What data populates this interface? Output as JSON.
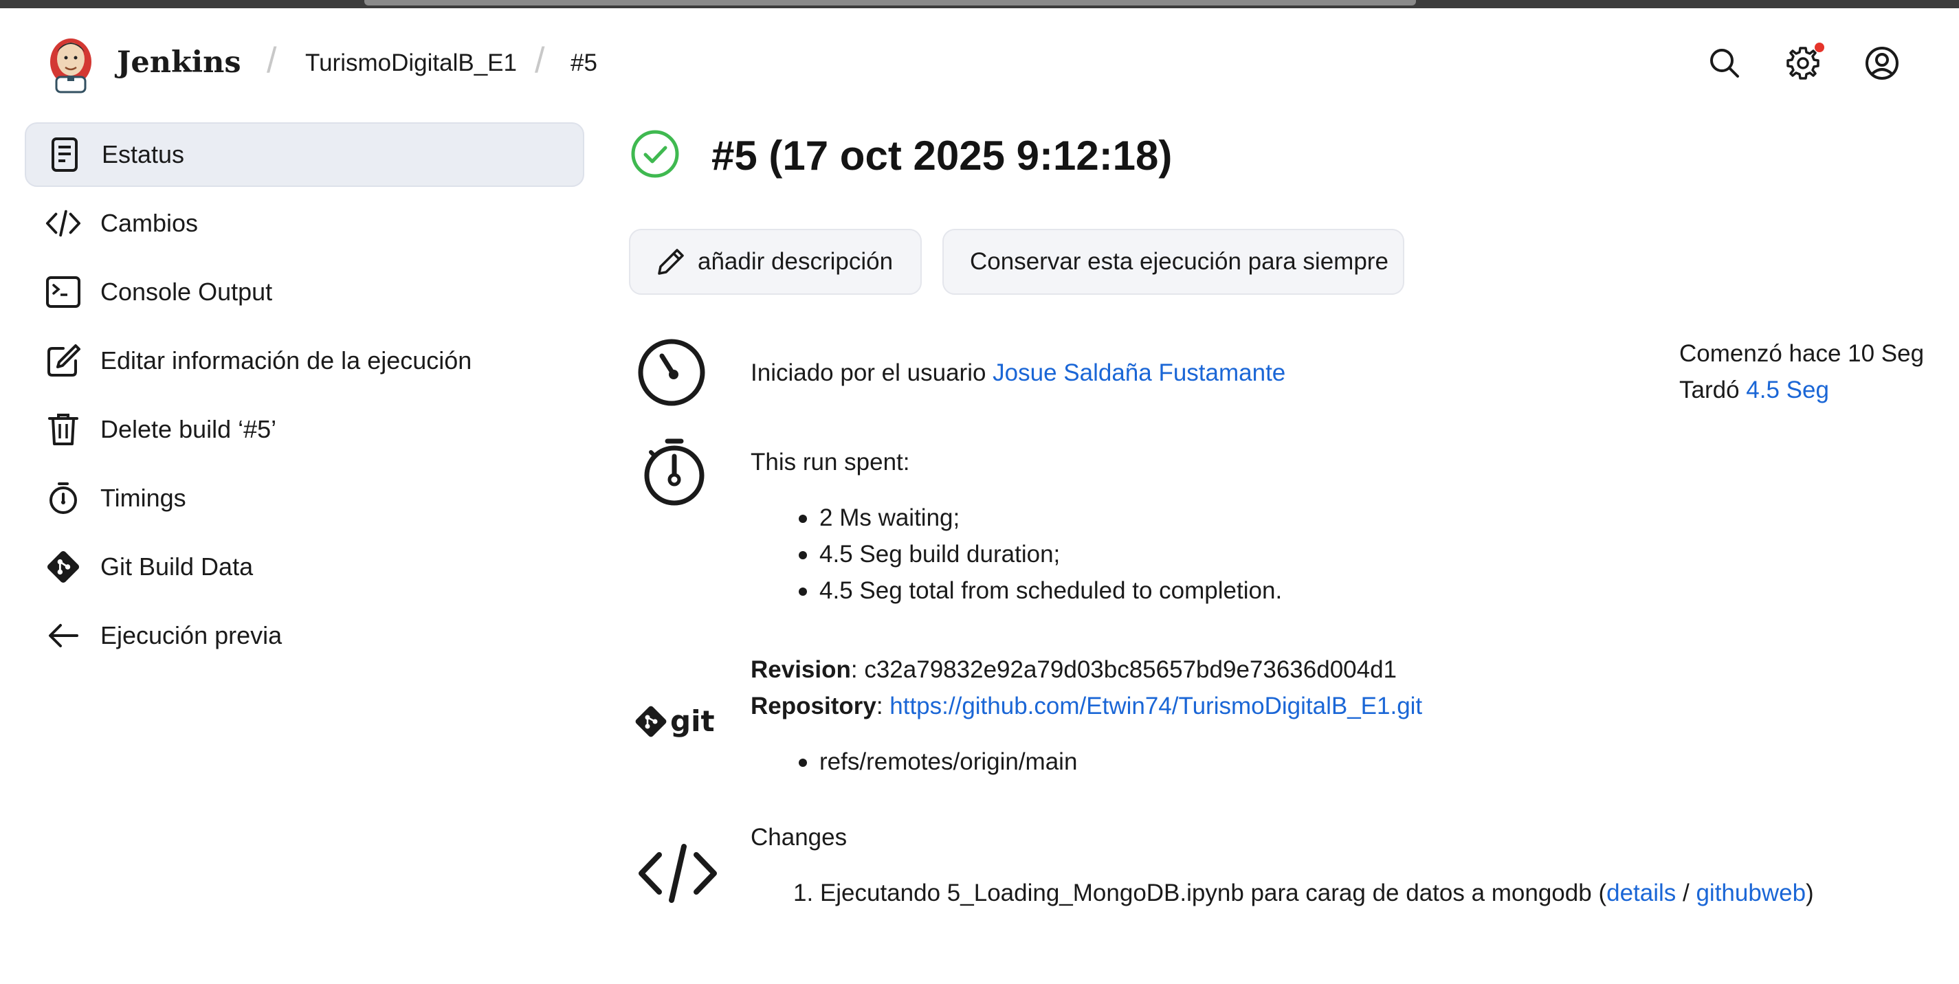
{
  "app": {
    "brand": "Jenkins",
    "breadcrumb": [
      "TurismoDigitalB_E1",
      "#5"
    ],
    "settings_has_notification": true
  },
  "colors": {
    "link": "#1a66d6",
    "success": "#3fb950",
    "active_bg": "#eaedf3",
    "notification": "#e5342a"
  },
  "sidebar": {
    "items": [
      {
        "label": "Estatus",
        "icon": "document-icon",
        "active": true
      },
      {
        "label": "Cambios",
        "icon": "code-icon"
      },
      {
        "label": "Console Output",
        "icon": "terminal-icon"
      },
      {
        "label": "Editar información de la ejecución",
        "icon": "edit-icon"
      },
      {
        "label": "Delete build ‘#5’",
        "icon": "trash-icon"
      },
      {
        "label": "Timings",
        "icon": "stopwatch-icon"
      },
      {
        "label": "Git Build Data",
        "icon": "git-icon"
      },
      {
        "label": "Ejecución previa",
        "icon": "arrow-left-icon"
      }
    ]
  },
  "build": {
    "title": "#5 (17 oct 2025 9:12:18)",
    "status_icon": "success-check-icon",
    "buttons": {
      "add_description": "añadir descripción",
      "keep_forever": "Conservar esta ejecución para siempre"
    },
    "started": {
      "prefix": "Iniciado por el usuario ",
      "user": "Josue Saldaña Fustamante",
      "started_ago": "Comenzó hace 10 Seg",
      "took_label": "Tardó ",
      "took_value": "4.5 Seg"
    },
    "timing": {
      "heading": "This run spent:",
      "items": [
        "2 Ms waiting;",
        "4.5 Seg build duration;",
        "4.5 Seg total from scheduled to completion."
      ]
    },
    "git": {
      "revision_label": "Revision",
      "revision": "c32a79832e92a79d03bc85657bd9e73636d004d1",
      "repository_label": "Repository",
      "repository": "https://github.com/Etwin74/TurismoDigitalB_E1.git",
      "branches": [
        "refs/remotes/origin/main"
      ],
      "logo_text": "git"
    },
    "changes": {
      "heading": "Changes",
      "items": [
        {
          "number": "1.",
          "message": "Ejecutando 5_Loading_MongoDB.ipynb para carag de datos a mongodb",
          "details": "details",
          "separator": " / ",
          "githubweb": "githubweb"
        }
      ]
    }
  }
}
